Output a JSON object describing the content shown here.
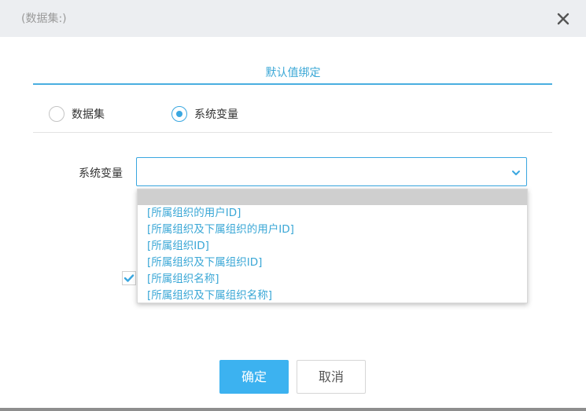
{
  "dialog": {
    "title": "(数据集:)",
    "close_icon": "close-icon"
  },
  "section": {
    "title": "默认值绑定"
  },
  "radios": [
    {
      "label": "数据集",
      "checked": false
    },
    {
      "label": "系统变量",
      "checked": true
    }
  ],
  "field": {
    "label": "系统变量",
    "value": "",
    "icon": "chevron-down-icon"
  },
  "dropdown": {
    "options": [
      "",
      "[所属组织的用户ID]",
      "[所属组织及下属组织的用户ID]",
      "[所属组织ID]",
      "[所属组织及下属组织ID]",
      "[所属组织名称]",
      "[所属组织及下属组织名称]"
    ]
  },
  "checkbox": {
    "checked": true,
    "icon": "checkmark-icon"
  },
  "buttons": {
    "ok": "确定",
    "cancel": "取消"
  },
  "colors": {
    "accent": "#3aa7e0",
    "primary_button": "#3cb2f0",
    "option_text": "#3aa7d6",
    "titlebar": "#eceef1"
  }
}
